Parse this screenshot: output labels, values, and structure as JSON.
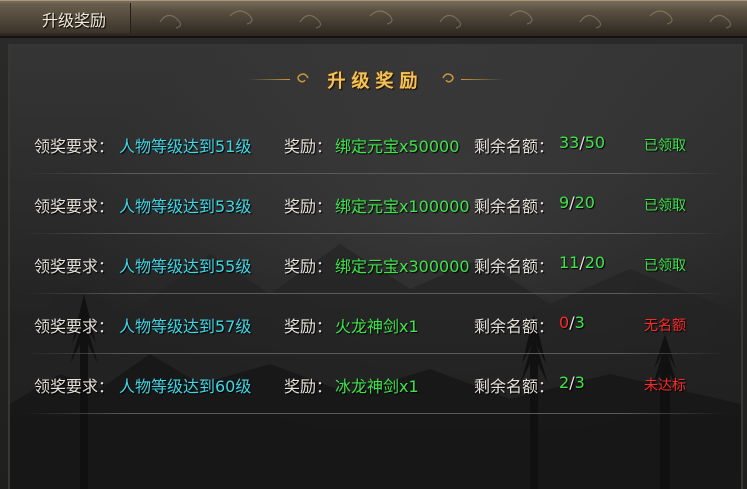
{
  "window": {
    "title": "升级奖励"
  },
  "panel": {
    "header": "升级奖励"
  },
  "labels": {
    "requirement": "领奖要求：",
    "reward": "奖励：",
    "remaining": "剩余名额：",
    "slash": "/"
  },
  "rows": [
    {
      "requirement": "人物等级达到51级",
      "reward": "绑定元宝x50000",
      "remaining": "33",
      "total": "50",
      "status": "已领取",
      "status_color": "#3ee44a",
      "remaining_color": "#3ee44a"
    },
    {
      "requirement": "人物等级达到53级",
      "reward": "绑定元宝x100000",
      "remaining": "9",
      "total": "20",
      "status": "已领取",
      "status_color": "#3ee44a",
      "remaining_color": "#3ee44a"
    },
    {
      "requirement": "人物等级达到55级",
      "reward": "绑定元宝x300000",
      "remaining": "11",
      "total": "20",
      "status": "已领取",
      "status_color": "#3ee44a",
      "remaining_color": "#3ee44a"
    },
    {
      "requirement": "人物等级达到57级",
      "reward": "火龙神剑x1",
      "remaining": "0",
      "total": "3",
      "status": "无名额",
      "status_color": "#ff2a2a",
      "remaining_color": "#ff2a2a"
    },
    {
      "requirement": "人物等级达到60级",
      "reward": "冰龙神剑x1",
      "remaining": "2",
      "total": "3",
      "status": "未达标",
      "status_color": "#ff2a2a",
      "remaining_color": "#3ee44a"
    }
  ],
  "colors": {
    "accent_gold": "#f2c25a",
    "requirement_cyan": "#3fd6e6",
    "reward_green": "#3ee44a",
    "warning_red": "#ff2a2a"
  }
}
